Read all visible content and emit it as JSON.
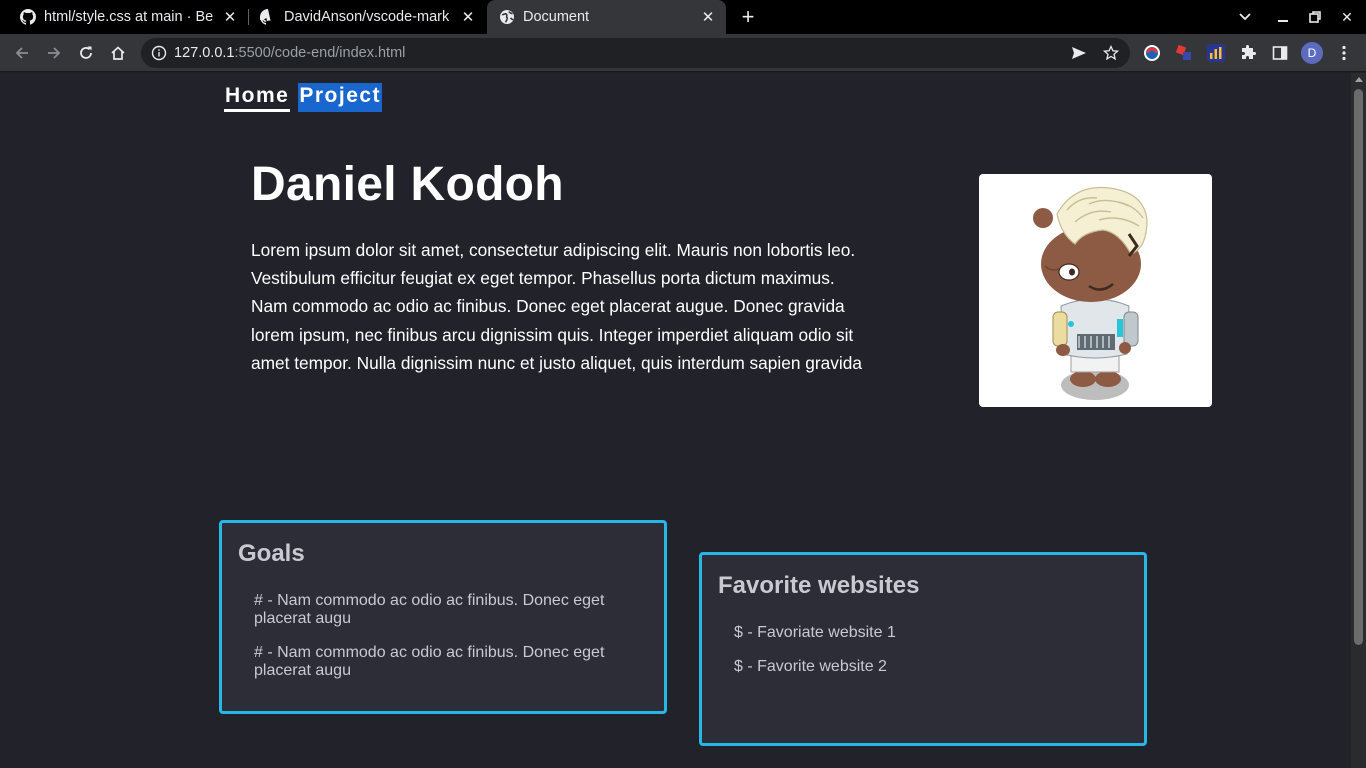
{
  "browser": {
    "tabs": [
      {
        "title": "html/style.css at main · Be",
        "favicon": "github-icon",
        "active": false
      },
      {
        "title": "DavidAnson/vscode-mark",
        "favicon": "github-icon",
        "active": false
      },
      {
        "title": "Document",
        "favicon": "globe-icon",
        "active": true
      }
    ],
    "url_host": "127.0.0.1",
    "url_path": ":5500/code-end/index.html",
    "profile_initial": "D",
    "colors": {
      "tabbar": "#000000",
      "toolbar": "#35363a",
      "omnibox": "#202124"
    }
  },
  "page": {
    "nav": {
      "home_label": "Home",
      "project_label": "Project"
    },
    "hero": {
      "name": "Daniel Kodoh",
      "bio": "Lorem ipsum dolor sit amet, consectetur adipiscing elit. Mauris non lobortis leo. Vestibulum efficitur feugiat ex eget tempor. Phasellus porta dictum maximus. Nam commodo ac odio ac finibus. Donec eget placerat augue. Donec gravida lorem ipsum, nec finibus arcu dignissim quis. Integer imperdiet aliquam odio sit amet tempor. Nulla dignissim nunc et justo aliquet, quis interdum sapien gravida",
      "avatar": "reddit-snoo-avatar"
    },
    "goals": {
      "title": "Goals",
      "items": [
        "# - Nam commodo ac odio ac finibus. Donec eget placerat augu",
        "# - Nam commodo ac odio ac finibus. Donec eget placerat augu"
      ]
    },
    "favorites": {
      "title": "Favorite websites",
      "items": [
        "$ - Favoriate website 1",
        "$ - Favorite website 2"
      ]
    },
    "colors": {
      "background": "#22222b",
      "card": "#2d2d38",
      "card_border": "#27b7e6",
      "nav_highlight": "#1a66cf"
    }
  }
}
